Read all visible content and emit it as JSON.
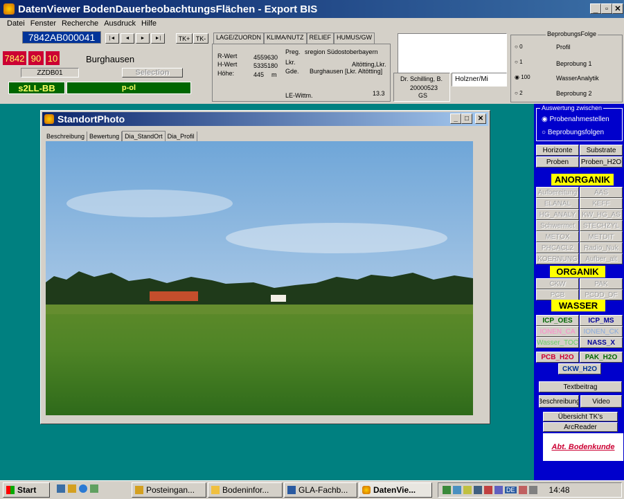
{
  "app": {
    "title": "DatenViewer BodenDauerbeobachtungsFlächen - Export BIS",
    "controls": [
      "_",
      "▫",
      "✕"
    ]
  },
  "menu": [
    "Datei",
    "Fenster",
    "Recherche",
    "Ausdruck",
    "Hilfe"
  ],
  "record": {
    "id": "7842AB000041",
    "nav": [
      "|◄",
      "◄",
      "►",
      "►|"
    ],
    "tk_plus": "TK+",
    "tk_minus": "TK-",
    "code_a": "7842",
    "code_b": "90",
    "code_c": "10",
    "name": "Burghausen",
    "zzdb": "ZZDB01",
    "selection": "Selection",
    "class_a": "s2LL-BB",
    "class_b": "p-ol"
  },
  "tabs_top": [
    "LAGE/ZUORDN",
    "KLIMA/NUTZ",
    "RELIEF",
    "HUMUS/GW"
  ],
  "lage": {
    "r_label": "R-Wert",
    "r_value": "4559630",
    "h_label": "H-Wert",
    "h_value": "5335180",
    "hoehe_label": "Höhe:",
    "hoehe_value": "445",
    "hoehe_unit": "m",
    "preg_label": "Preg.",
    "preg_value": "sregion Südostoberbayern",
    "lkr_label": "Lkr.",
    "lkr_value": "Altötting,Lkr.",
    "gde_label": "Gde.",
    "gde_value": "Burghausen [Lkr. Altötting]",
    "le_label": "LE-Wittm.",
    "le_value": "13.3"
  },
  "person": {
    "name": "Dr. Schilling, B.",
    "date": "20000523",
    "code": "GS",
    "field": "Holzner/Mi"
  },
  "beprobung": {
    "legend": "BeprobungsFolge",
    "options": [
      {
        "radio": "0",
        "label": "Profil",
        "checked": false
      },
      {
        "radio": "1",
        "label": "Beprobung 1",
        "checked": false
      },
      {
        "radio": "100",
        "label": "WasserAnalytik",
        "checked": true
      },
      {
        "radio": "2",
        "label": "Beprobung 2",
        "checked": false
      }
    ]
  },
  "photo_window": {
    "title": "StandortPhoto",
    "tabs": [
      "Beschreibung",
      "Bewertung",
      "Dia_StandOrt",
      "Dia_Profil"
    ],
    "active_tab": "Dia_StandOrt"
  },
  "right_panel": {
    "auswertung_legend": "Auswertung zwischen",
    "auswertung_options": [
      "Probenahmestellen",
      "Beprobungsfolgen"
    ],
    "btn_horizonte": "Horizonte",
    "btn_substrate": "Substrate",
    "btn_proben": "Proben",
    "btn_proben_h2o": "Proben_H2O",
    "anorganik": "ANORGANIK",
    "anorganik_items": [
      "Aufbereitung",
      "AAS",
      "ELANAL",
      "KEFF",
      "HG_ANALY",
      "KW_HG_AS",
      "Schwermet",
      "STECHZYL",
      "METOX",
      "METDIT",
      "PHCACL2",
      "Radio_Nuk",
      "KOERNUNG",
      "Aufber_alt"
    ],
    "organik": "ORGANIK",
    "organik_items": [
      "CKW",
      "PAK",
      "PCB",
      "PCDD_DF"
    ],
    "wasser": "WASSER",
    "wasser_items": [
      "ICP_OES",
      "ICP_MS",
      "IONEN_CA",
      "IONEN_CK",
      "Wasser_TOC",
      "NASS_X"
    ],
    "h2o_items": [
      "PCB_H2O",
      "PAK_H2O",
      "CKW_H2O"
    ],
    "textbeitrag": "Textbeitrag",
    "beschreibung": "Beschreibung",
    "video": "Video",
    "uebersicht": "Übersicht TK's",
    "arcreader": "ArcReader",
    "logo_text": "Abt. Bodenkunde"
  },
  "taskbar": {
    "start": "Start",
    "items": [
      "Posteingan...",
      "Bodeninfor...",
      "GLA-Fachb...",
      "DatenVie..."
    ],
    "clock": "14:48",
    "tray_lang": "DE"
  },
  "colors": {
    "teal": "#008080",
    "face": "#d4d0c8",
    "title_blue": "#0a246a",
    "panel_blue": "#0000cc",
    "code_red": "#cc0033",
    "class_green": "#006600",
    "yellow": "#ffff00"
  }
}
